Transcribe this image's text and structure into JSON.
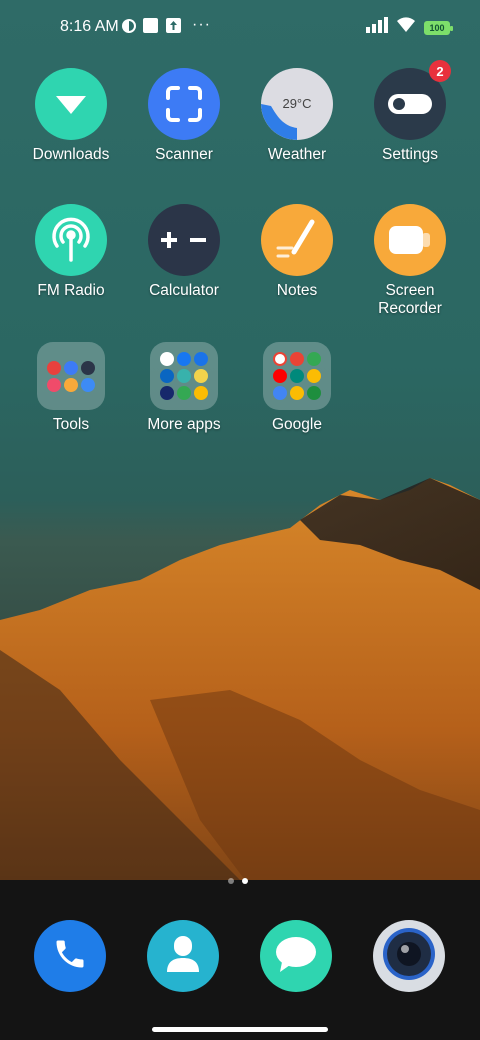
{
  "status_bar": {
    "time": "8:16 AM",
    "battery": "100"
  },
  "apps": [
    {
      "label": "Downloads",
      "color": "#2fd5b0"
    },
    {
      "label": "Scanner",
      "color": "#3d7bf5"
    },
    {
      "label": "Weather",
      "color": "#d9d9de",
      "temp": "29°C"
    },
    {
      "label": "Settings",
      "color": "#2b3a4a",
      "badge": "2"
    },
    {
      "label": "FM Radio",
      "color": "#2fd5b0"
    },
    {
      "label": "Calculator",
      "color": "#2b3548"
    },
    {
      "label": "Notes",
      "color": "#f8a93a"
    },
    {
      "label": "Screen Recorder",
      "color": "#f8a93a"
    },
    {
      "label": "Tools"
    },
    {
      "label": "More apps"
    },
    {
      "label": "Google"
    }
  ],
  "dock": [
    {
      "name": "Phone",
      "color": "#1f7de8"
    },
    {
      "name": "Contacts",
      "color": "#26b3cf"
    },
    {
      "name": "Messages",
      "color": "#2fd5b0"
    },
    {
      "name": "Camera",
      "color": "#d9dde3"
    }
  ],
  "page_indicator": {
    "pages": 2,
    "current": 2
  }
}
